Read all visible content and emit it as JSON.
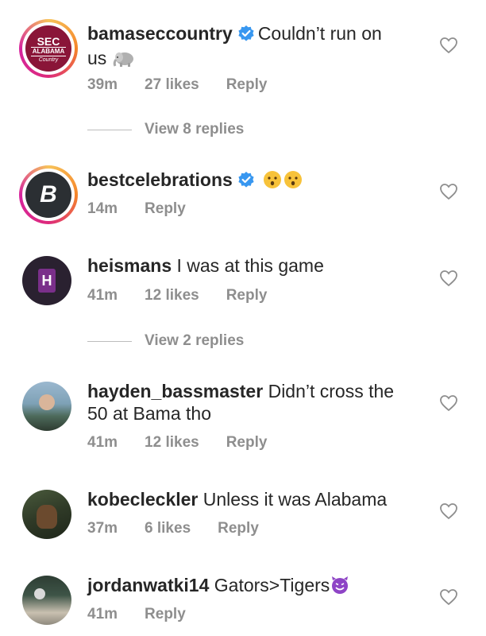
{
  "comments": [
    {
      "username": "bamaseccountry",
      "verified": true,
      "text": "Couldn’t run on us",
      "emoji": "elephant",
      "time": "39m",
      "likes": "27 likes",
      "reply": "Reply",
      "avatar": {
        "line1": "SEC",
        "line2": "ALABAMA",
        "line3": "Country"
      }
    },
    {
      "username": "bestcelebrations",
      "verified": true,
      "text": "",
      "emoji": "hushed-faces",
      "time": "14m",
      "likes": "",
      "reply": "Reply",
      "avatar": {
        "letter": "B"
      }
    },
    {
      "username": "heismans",
      "verified": false,
      "text": "I was at this game",
      "time": "41m",
      "likes": "12 likes",
      "reply": "Reply",
      "avatar": {
        "letter": "H"
      }
    },
    {
      "username": "hayden_bassmaster",
      "verified": false,
      "text": "Didn’t cross the 50 at Bama tho",
      "time": "41m",
      "likes": "12 likes",
      "reply": "Reply"
    },
    {
      "username": "kobecleckler",
      "verified": false,
      "text": "Unless it was Alabama",
      "time": "37m",
      "likes": "6 likes",
      "reply": "Reply"
    },
    {
      "username": "jordanwatki14",
      "verified": false,
      "text": "Gators>Tigers",
      "emoji": "smiling-devil",
      "time": "41m",
      "likes": "",
      "reply": "Reply"
    }
  ],
  "view_replies": [
    "View 8 replies",
    "View 2 replies"
  ],
  "colors": {
    "verified": "#3897f0",
    "muted": "#8e8e8e",
    "text": "#262626",
    "bama": "#8a1538"
  }
}
